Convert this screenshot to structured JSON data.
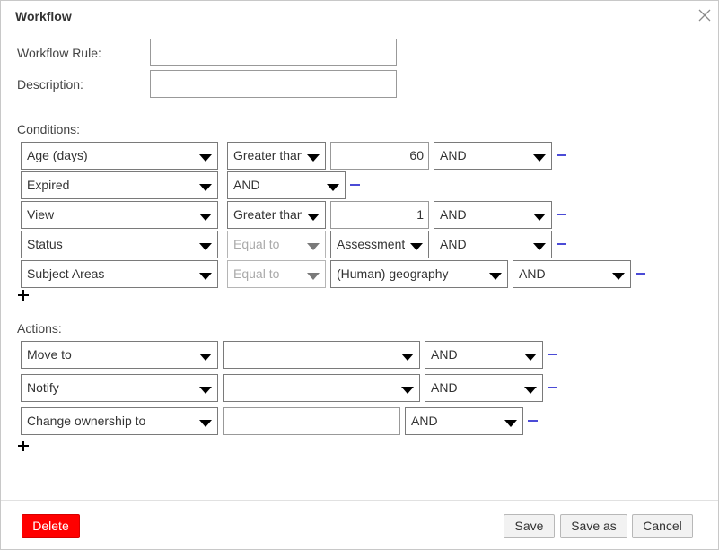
{
  "dialog": {
    "title": "Workflow",
    "close_icon": "close-icon"
  },
  "fields": {
    "workflow_rule_label": "Workflow Rule:",
    "workflow_rule_value": "",
    "description_label": "Description:",
    "description_value": ""
  },
  "conditions": {
    "label": "Conditions:",
    "rows": [
      {
        "field": "Age (days)",
        "operator": "Greater than",
        "value": "60",
        "logic": "AND"
      },
      {
        "field": "Expired",
        "logic": "AND"
      },
      {
        "field": "View",
        "operator": "Greater than",
        "value": "1",
        "logic": "AND"
      },
      {
        "field": "Status",
        "operator": "Equal to",
        "value": "Assessment",
        "logic": "AND"
      },
      {
        "field": "Subject Areas",
        "operator": "Equal to",
        "value": "(Human) geography",
        "logic": "AND"
      }
    ],
    "add_icon": "plus-icon",
    "remove_icon": "minus-icon"
  },
  "actions": {
    "label": "Actions:",
    "rows": [
      {
        "action": "Move to",
        "target": "",
        "logic": "AND"
      },
      {
        "action": "Notify",
        "target": "",
        "logic": "AND"
      },
      {
        "action": "Change ownership to",
        "target": "",
        "logic": "AND"
      }
    ],
    "add_icon": "plus-icon",
    "remove_icon": "minus-icon"
  },
  "footer": {
    "delete": "Delete",
    "save": "Save",
    "save_as": "Save as",
    "cancel": "Cancel"
  },
  "colors": {
    "accent_minus": "#4b4bd6",
    "delete_button": "#ff0000"
  }
}
